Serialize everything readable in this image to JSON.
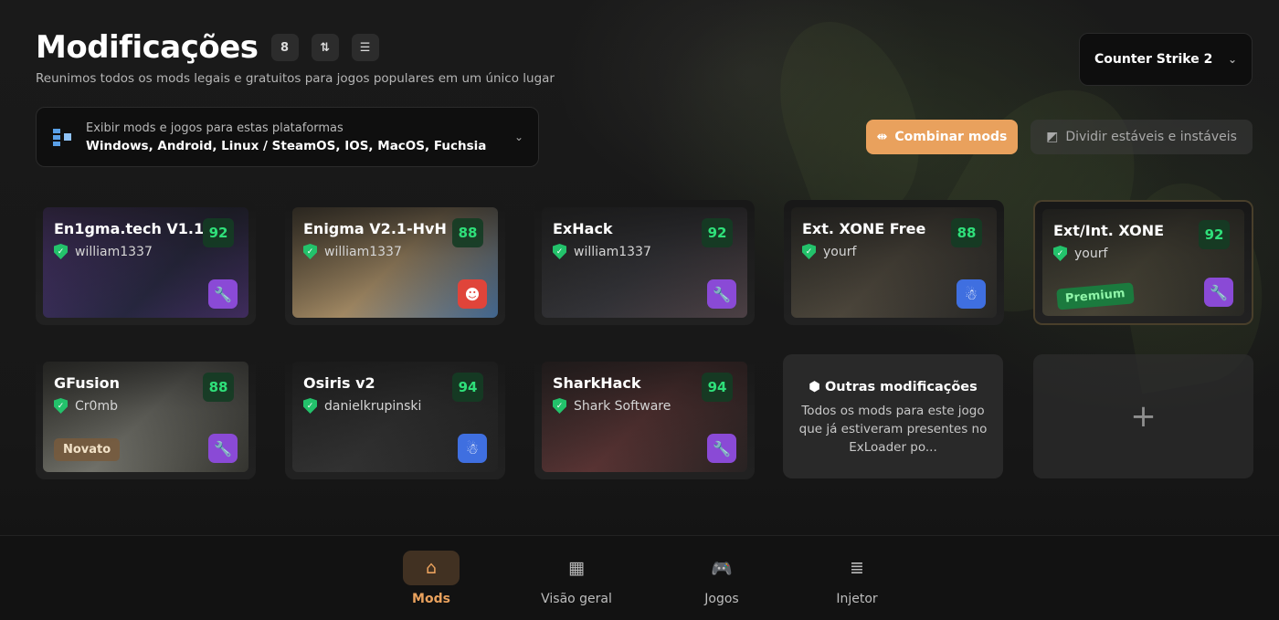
{
  "header": {
    "title": "Modificações",
    "count": "8",
    "sort_icon": "sort-icon",
    "filter_icon": "sliders-icon",
    "subtitle": "Reunimos todos os mods legais e gratuitos para jogos populares em um único lugar"
  },
  "game_select": {
    "value": "Counter Strike 2"
  },
  "platforms": {
    "label": "Exibir mods e jogos para estas plataformas",
    "value": "Windows, Android, Linux / SteamOS, IOS, MacOS, Fuchsia"
  },
  "actions": {
    "combine_label": "Combinar mods",
    "split_label": "Dividir estáveis e instáveis"
  },
  "mods": [
    {
      "name": "En1gma.tech V1.1",
      "author": "william1337",
      "score": "92",
      "tool": "wrench",
      "color": "#8a4ad6"
    },
    {
      "name": "Enigma V2.1-HvH",
      "author": "william1337",
      "score": "88",
      "tool": "face",
      "color": "#e0443a"
    },
    {
      "name": "ExHack",
      "author": "william1337",
      "score": "92",
      "tool": "wrench",
      "color": "#8a4ad6"
    },
    {
      "name": "Ext. XONE Free",
      "author": "yourf",
      "score": "88",
      "tool": "ghost",
      "color": "#3f6fe0"
    },
    {
      "name": "Ext/Int. XONE",
      "author": "yourf",
      "score": "92",
      "tool": "wrench",
      "color": "#8a4ad6",
      "badge": "Premium"
    },
    {
      "name": "GFusion",
      "author": "Cr0mb",
      "score": "88",
      "tool": "wrench",
      "color": "#8a4ad6",
      "badge": "Novato"
    },
    {
      "name": "Osiris v2",
      "author": "danielkrupinski",
      "score": "94",
      "tool": "ghost",
      "color": "#3f6fe0"
    },
    {
      "name": "SharkHack",
      "author": "Shark Software",
      "score": "94",
      "tool": "wrench",
      "color": "#8a4ad6"
    }
  ],
  "other": {
    "title": "Outras modificações",
    "description": "Todos os mods para este jogo que já estiveram presentes no ExLoader po..."
  },
  "add_label": "+",
  "nav": [
    {
      "label": "Mods",
      "icon": "home-icon",
      "active": true
    },
    {
      "label": "Visão geral",
      "icon": "chart-board-icon",
      "active": false
    },
    {
      "label": "Jogos",
      "icon": "gamepad-icon",
      "active": false
    },
    {
      "label": "Injetor",
      "icon": "database-icon",
      "active": false
    }
  ],
  "colors": {
    "accent": "#e9a15d",
    "score_green": "#2fe07a",
    "background": "#161616"
  }
}
